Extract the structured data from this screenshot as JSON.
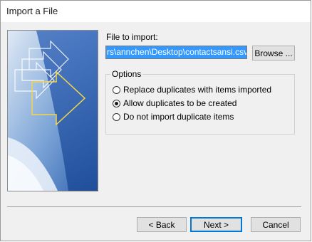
{
  "window": {
    "title": "Import a File"
  },
  "file_import": {
    "label": "File to import:",
    "value": "rs\\annchen\\Desktop\\contactsansi.csv",
    "browse_label": "Browse ..."
  },
  "options": {
    "legend": "Options",
    "items": [
      {
        "label": "Replace duplicates with items imported",
        "checked": false
      },
      {
        "label": "Allow duplicates to be created",
        "checked": true
      },
      {
        "label": "Do not import duplicate items",
        "checked": false
      }
    ]
  },
  "footer": {
    "back_label": "< Back",
    "next_label": "Next >",
    "cancel_label": "Cancel"
  },
  "colors": {
    "selection": "#3399ff",
    "default_button_border": "#0078d7",
    "dialog_bg": "#f0f0f0"
  }
}
